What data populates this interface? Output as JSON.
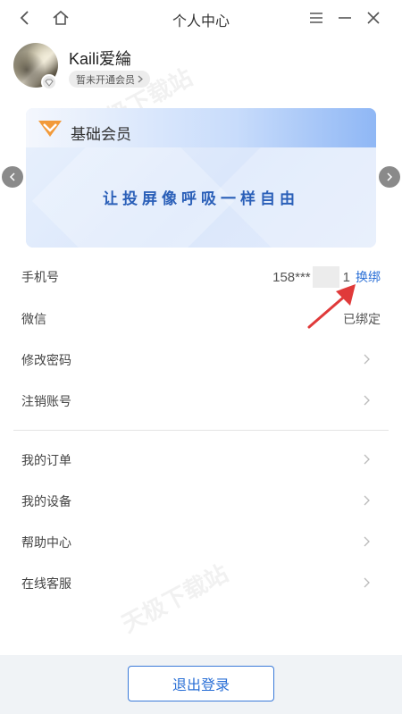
{
  "window": {
    "title": "个人中心"
  },
  "profile": {
    "username": "Kaili爱綸",
    "vip_status": "暂未开通会员"
  },
  "membership_card": {
    "title": "基础会员",
    "slogan": "让投屏像呼吸一样自由"
  },
  "account_rows": [
    {
      "label": "手机号",
      "value_prefix": "158***",
      "value_suffix": "1",
      "action": "换绑"
    },
    {
      "label": "微信",
      "value": "已绑定"
    },
    {
      "label": "修改密码"
    },
    {
      "label": "注销账号"
    }
  ],
  "service_rows": [
    {
      "label": "我的订单"
    },
    {
      "label": "我的设备"
    },
    {
      "label": "帮助中心"
    },
    {
      "label": "在线客服"
    }
  ],
  "footer": {
    "logout_label": "退出登录"
  },
  "watermark": "天极下载站",
  "colors": {
    "accent": "#2a6fd6",
    "annotation_arrow": "#e03a3a",
    "card_slogan": "#2a5fb8"
  },
  "icons": {
    "back": "chevron-left-icon",
    "home": "home-icon",
    "menu": "menu-icon",
    "minimize": "minimize-icon",
    "close": "close-icon",
    "vip_badge": "diamond-icon",
    "crown": "crown-icon"
  }
}
